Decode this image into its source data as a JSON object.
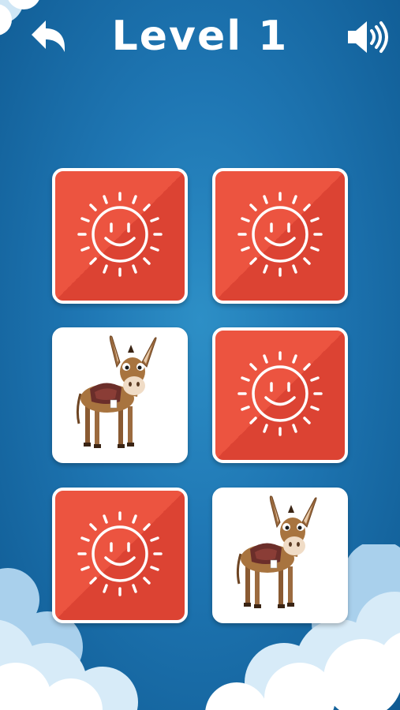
{
  "header": {
    "back_icon": "back-arrow-icon",
    "title": "Level 1",
    "sound_icon": "speaker-icon"
  },
  "colors": {
    "background": "#1f77b4",
    "card_back": "#ec5440",
    "card_back_shade": "#dc4333",
    "card_border": "#ffffff",
    "card_face": "#ffffff"
  },
  "cards": [
    {
      "state": "face-down",
      "icon": "sun-icon"
    },
    {
      "state": "face-down",
      "icon": "sun-icon"
    },
    {
      "state": "face-up",
      "icon": "donkey-icon"
    },
    {
      "state": "face-down",
      "icon": "sun-icon"
    },
    {
      "state": "face-down",
      "icon": "sun-icon"
    },
    {
      "state": "face-up",
      "icon": "donkey-icon"
    }
  ]
}
